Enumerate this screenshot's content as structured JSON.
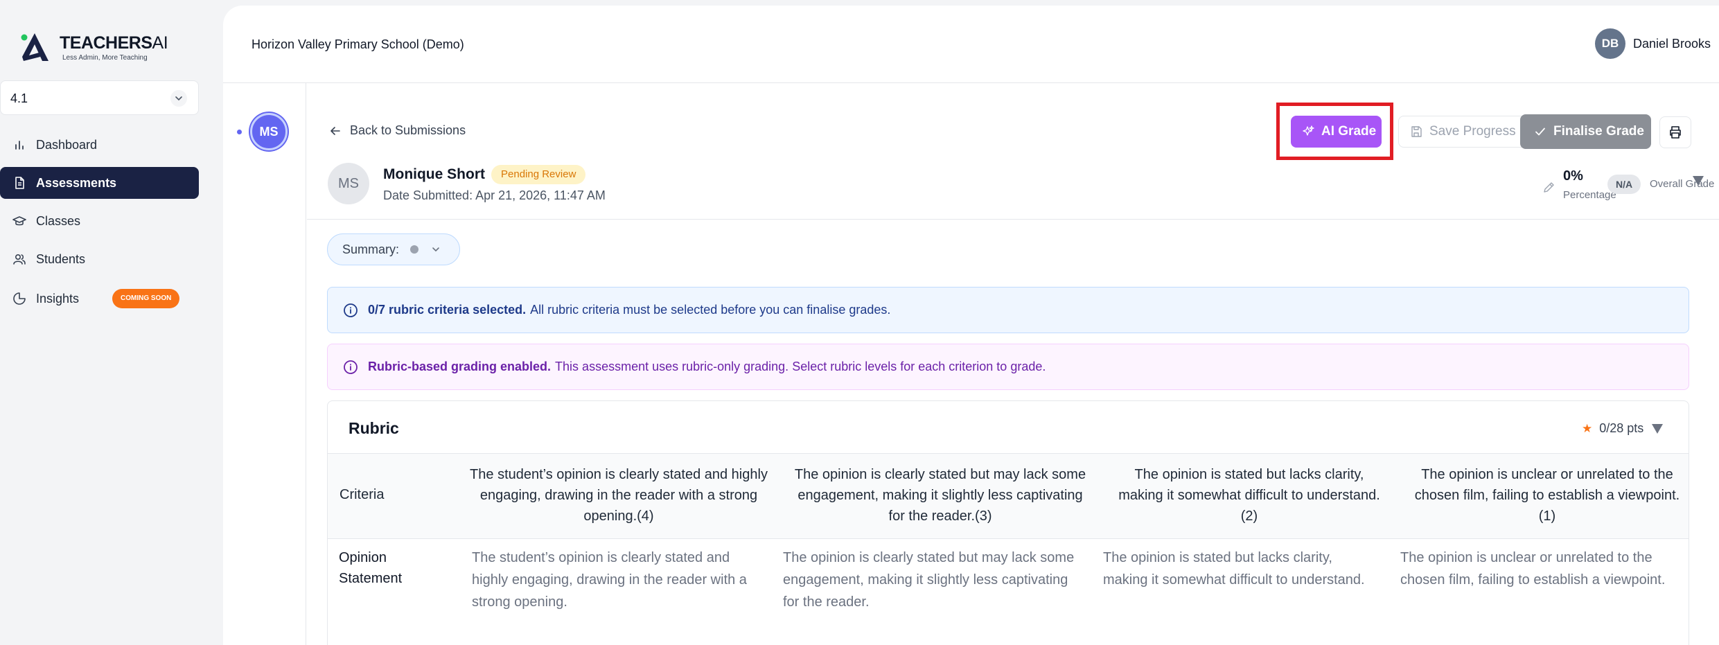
{
  "app": {
    "logo_title": "TEACHERS",
    "logo_title_suffix": "AI",
    "logo_tagline": "Less Admin, More Teaching",
    "brand_color": "#1a2244"
  },
  "sidebar": {
    "version_value": "4.1",
    "items": [
      {
        "label": "Dashboard",
        "icon": "bar-chart-icon"
      },
      {
        "label": "Assessments",
        "icon": "document-icon",
        "active": true
      },
      {
        "label": "Classes",
        "icon": "graduation-cap-icon"
      },
      {
        "label": "Students",
        "icon": "users-icon"
      },
      {
        "label": "Insights",
        "icon": "pie-chart-icon",
        "badge": "COMING SOON"
      }
    ]
  },
  "header": {
    "school_name": "Horizon Valley Primary School (Demo)",
    "user_initials": "DB",
    "user_name": "Daniel Brooks"
  },
  "rail": {
    "student_initials": "MS"
  },
  "toolbar": {
    "back_label": "Back to Submissions",
    "ai_grade_label": "AI Grade",
    "save_label": "Save Progress",
    "finalise_label": "Finalise Grade",
    "ai_color": "#a855f7"
  },
  "submission": {
    "initials": "MS",
    "student_name": "Monique Short",
    "status": "Pending Review",
    "date_submitted": "Date Submitted: Apr 21, 2026, 11:47 AM",
    "percentage": "0%",
    "percentage_label": "Percentage",
    "grade_value": "N/A",
    "grade_label": "Overall Grade"
  },
  "summary": {
    "label": "Summary:"
  },
  "alerts": {
    "criteria_bold": "0/7 rubric criteria selected.",
    "criteria_text": "All rubric criteria must be selected before you can finalise grades.",
    "rubric_bold": "Rubric-based grading enabled.",
    "rubric_text": "This assessment uses rubric-only grading. Select rubric levels for each criterion to grade."
  },
  "rubric": {
    "title": "Rubric",
    "points": "0/28 pts",
    "criteria_header": "Criteria",
    "levels": [
      "The student’s opinion is clearly stated and highly engaging, drawing in the reader with a strong opening.(4)",
      "The opinion is clearly stated but may lack some engagement, making it slightly less captivating for the reader.(3)",
      "The opinion is stated but lacks clarity, making it somewhat difficult to understand.(2)",
      "The opinion is unclear or unrelated to the chosen film, failing to establish a viewpoint.(1)"
    ],
    "rows": [
      {
        "criterion": "Opinion Statement",
        "cells": [
          "The student’s opinion is clearly stated and highly engaging, drawing in the reader with a strong opening.",
          "The opinion is clearly stated but may lack some engagement, making it slightly less captivating for the reader.",
          "The opinion is stated but lacks clarity, making it somewhat difficult to understand.",
          "The opinion is unclear or unrelated to the chosen film, failing to establish a viewpoint."
        ]
      }
    ]
  }
}
